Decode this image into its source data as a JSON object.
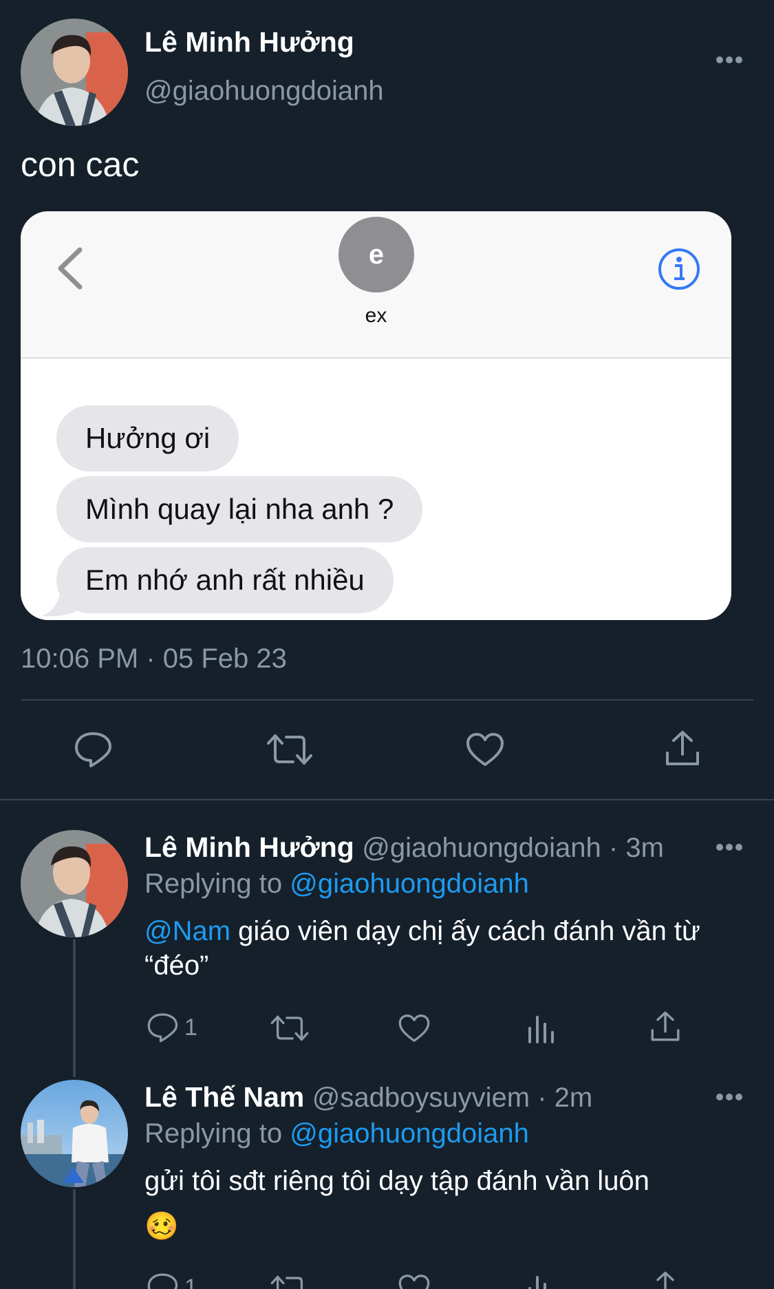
{
  "tweet": {
    "author_name": "Lê Minh Hưởng",
    "author_handle": "@giaohuongdoianh",
    "text": "con cac",
    "more_label": "•••",
    "timestamp": "10:06 PM · 05 Feb 23",
    "embedded_screenshot": {
      "contact_initial": "e",
      "contact_name": "ex",
      "messages": [
        "Hưởng ơi",
        "Mình quay lại nha anh ?",
        "Em nhớ anh rất nhiều"
      ]
    }
  },
  "replies": [
    {
      "author_name": "Lê Minh Hưởng",
      "author_handle": "@giaohuongdoianh · 3m",
      "replying_prefix": "Replying to ",
      "replying_to": "@giaohuongdoianh",
      "mention": "@Nam",
      "text": " giáo viên dạy chị ấy cách đánh vần từ “đéo”",
      "reply_count": "1"
    },
    {
      "author_name": "Lê Thế Nam",
      "author_handle": "@sadboysuyviem · 2m",
      "replying_prefix": "Replying to ",
      "replying_to": "@giaohuongdoianh",
      "text": "gửi tôi sđt riêng tôi dạy tập đánh vần luôn",
      "emoji": "🥴",
      "reply_count": "1"
    }
  ],
  "colors": {
    "background": "#15202b",
    "secondary_text": "#8b98a5",
    "link": "#1d9bf0",
    "divider": "#38444d",
    "ios_blue": "#3478f6"
  },
  "icons": [
    "reply-icon",
    "retweet-icon",
    "like-icon",
    "share-icon",
    "analytics-icon",
    "more-icon",
    "back-chevron-icon",
    "info-icon"
  ]
}
